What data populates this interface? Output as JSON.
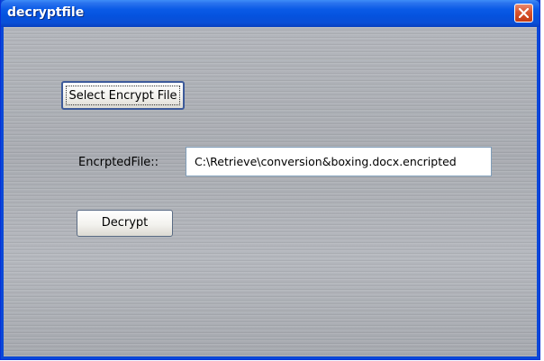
{
  "window": {
    "title": "decryptfile",
    "close_icon": "close-icon"
  },
  "form": {
    "select_button_label": "Select Encrypt File",
    "encrypted_file_label": "EncrptedFile::",
    "encrypted_file_value": "C:\\Retrieve\\conversion&boxing.docx.encripted",
    "decrypt_button_label": "Decrypt"
  },
  "colors": {
    "titlebar": "#0a5ae6",
    "close_button": "#d9542e",
    "client_background": "#adb0b6"
  }
}
